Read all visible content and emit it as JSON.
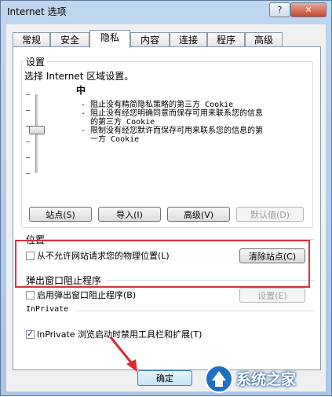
{
  "window": {
    "title": "Internet 选项",
    "help": "?",
    "close": "✕"
  },
  "tabs": [
    {
      "label": "常规"
    },
    {
      "label": "安全"
    },
    {
      "label": "隐私"
    },
    {
      "label": "内容"
    },
    {
      "label": "连接"
    },
    {
      "label": "程序"
    },
    {
      "label": "高级"
    }
  ],
  "settings": {
    "group_label": "设置",
    "zone_text": "选择 Internet 区域设置。",
    "level": "中",
    "desc_lines": [
      "- 阻止没有精简隐私策略的第三方 Cookie",
      "- 阻止没有经您明确同意而保存可用来联系您的信息",
      "  的第三方 Cookie",
      "- 限制没有经您默许而保存可用来联系您的信息的第",
      "  一方 Cookie"
    ],
    "buttons": {
      "sites": "站点(S)",
      "import": "导入(I)",
      "advanced": "高级(V)",
      "default": "默认值(D)"
    }
  },
  "location": {
    "group_label": "位置",
    "checkbox_label": "从不允许网站请求您的物理位置(L)",
    "checkbox_checked": false,
    "clear_button": "清除站点(C)"
  },
  "popup": {
    "group_label": "弹出窗口阻止程序",
    "checkbox_label": "启用弹出窗口阻止程序(B)",
    "checkbox_checked": false,
    "settings_button": "设置(E)"
  },
  "inprivate": {
    "group_label": "InPrivate",
    "checkbox_label": "InPrivate 浏览启动时禁用工具栏和扩展(T)",
    "checkbox_checked": true
  },
  "footer": {
    "ok": "确定"
  },
  "watermark": {
    "text": "系统之家"
  },
  "colors": {
    "highlight_box": "#d5323c",
    "arrow": "#e0282c"
  }
}
